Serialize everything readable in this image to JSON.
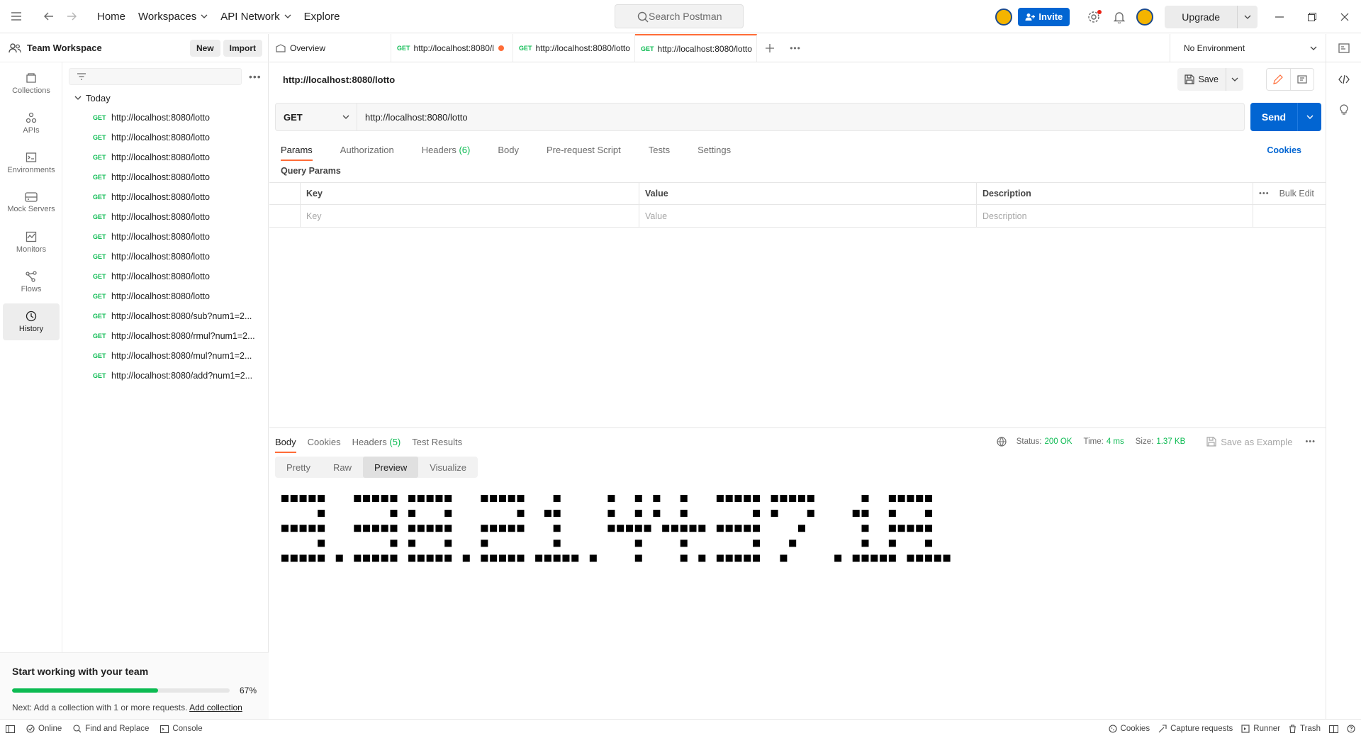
{
  "topbar": {
    "nav": [
      "Home",
      "Workspaces",
      "API Network",
      "Explore"
    ],
    "search_placeholder": "Search Postman",
    "invite_label": "Invite",
    "upgrade_label": "Upgrade"
  },
  "sidebar": {
    "workspace_name": "Team Workspace",
    "new_label": "New",
    "import_label": "Import",
    "rail": [
      {
        "label": "Collections",
        "icon": "collections-icon"
      },
      {
        "label": "APIs",
        "icon": "apis-icon"
      },
      {
        "label": "Environments",
        "icon": "environments-icon"
      },
      {
        "label": "Mock Servers",
        "icon": "mock-servers-icon"
      },
      {
        "label": "Monitors",
        "icon": "monitors-icon"
      },
      {
        "label": "Flows",
        "icon": "flows-icon"
      },
      {
        "label": "History",
        "icon": "history-icon",
        "active": true
      }
    ],
    "group_label": "Today",
    "history": [
      {
        "method": "GET",
        "url": "http://localhost:8080/lotto"
      },
      {
        "method": "GET",
        "url": "http://localhost:8080/lotto"
      },
      {
        "method": "GET",
        "url": "http://localhost:8080/lotto"
      },
      {
        "method": "GET",
        "url": "http://localhost:8080/lotto"
      },
      {
        "method": "GET",
        "url": "http://localhost:8080/lotto"
      },
      {
        "method": "GET",
        "url": "http://localhost:8080/lotto"
      },
      {
        "method": "GET",
        "url": "http://localhost:8080/lotto"
      },
      {
        "method": "GET",
        "url": "http://localhost:8080/lotto"
      },
      {
        "method": "GET",
        "url": "http://localhost:8080/lotto"
      },
      {
        "method": "GET",
        "url": "http://localhost:8080/lotto"
      },
      {
        "method": "GET",
        "url": "http://localhost:8080/sub?num1=2..."
      },
      {
        "method": "GET",
        "url": "http://localhost:8080/rmul?num1=2..."
      },
      {
        "method": "GET",
        "url": "http://localhost:8080/mul?num1=2..."
      },
      {
        "method": "GET",
        "url": "http://localhost:8080/add?num1=2..."
      }
    ],
    "team_card": {
      "title": "Start working with your team",
      "progress_pct": 67,
      "progress_label": "67%",
      "next_text": "Next: Add a collection with 1 or more requests.",
      "next_link": "Add collection"
    }
  },
  "tabs": {
    "overview_label": "Overview",
    "items": [
      {
        "method": "GET",
        "label": "http://localhost:8080/l",
        "unsaved": true
      },
      {
        "method": "GET",
        "label": "http://localhost:8080/lotto",
        "unsaved": false
      },
      {
        "method": "GET",
        "label": "http://localhost:8080/lotto",
        "unsaved": false,
        "active": true
      }
    ],
    "environment": "No Environment"
  },
  "request": {
    "name": "http://localhost:8080/lotto",
    "save_label": "Save",
    "method": "GET",
    "url": "http://localhost:8080/lotto",
    "send_label": "Send",
    "tabs": [
      "Params",
      "Authorization",
      "Headers",
      "Body",
      "Pre-request Script",
      "Tests",
      "Settings"
    ],
    "headers_count": "(6)",
    "cookies_label": "Cookies",
    "query_params_label": "Query Params",
    "columns": [
      "Key",
      "Value",
      "Description"
    ],
    "bulk_edit_label": "Bulk Edit",
    "placeholders": {
      "key": "Key",
      "value": "Value",
      "description": "Description"
    }
  },
  "response": {
    "tabs": [
      "Body",
      "Cookies",
      "Headers",
      "Test Results"
    ],
    "headers_count": "(5)",
    "status_label": "Status:",
    "status_value": "200 OK",
    "time_label": "Time:",
    "time_value": "4 ms",
    "size_label": "Size:",
    "size_value": "1.37 KB",
    "save_example_label": "Save as Example",
    "formats": [
      "Pretty",
      "Raw",
      "Preview",
      "Visualize"
    ],
    "active_format": "Preview"
  },
  "statusbar": {
    "left": [
      "Online",
      "Find and Replace",
      "Console"
    ],
    "right": [
      "Cookies",
      "Capture requests",
      "Runner",
      "Trash"
    ]
  }
}
